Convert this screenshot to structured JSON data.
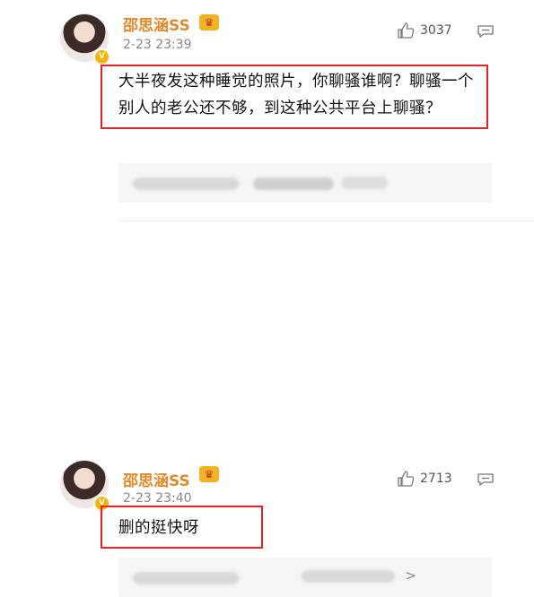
{
  "comments": [
    {
      "username": "邵思涵SS",
      "timestamp": "2-23 23:39",
      "like_count": "3037",
      "text": "大半夜发这种睡觉的照片，你聊骚谁啊？聊骚一个别人的老公还不够，到这种公共平台上聊骚？",
      "badge_icon": "vip-crown-icon",
      "verified_icon": "verified-v-icon"
    },
    {
      "username": "邵思涵SS",
      "timestamp": "2-23 23:40",
      "like_count": "2713",
      "text": "删的挺快呀",
      "badge_icon": "vip-crown-icon",
      "verified_icon": "verified-v-icon"
    }
  ],
  "colors": {
    "username": "#e28a2b",
    "highlight_border": "#e52222",
    "timestamp": "#888888",
    "reply_bg": "#f5f5f5"
  },
  "reply_chevron": ">"
}
